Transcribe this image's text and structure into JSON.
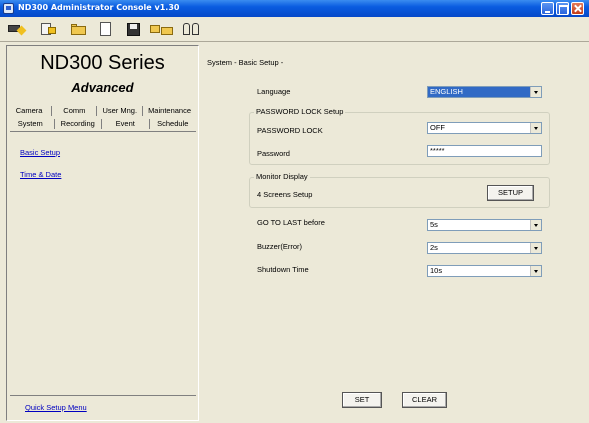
{
  "window": {
    "title": "ND300 Administrator Console v1.30"
  },
  "toolbar": {
    "icons": [
      "connect-icon",
      "login-icon",
      "open-folder-icon",
      "new-file-icon",
      "save-icon",
      "copy-folders-icon",
      "users-icon"
    ]
  },
  "sidebar": {
    "brand": "ND300 Series",
    "subtitle": "Advanced",
    "tabs_row1": [
      "Camera",
      "Comm",
      "User Mng.",
      "Maintenance"
    ],
    "tabs_row2": [
      "System",
      "Recording",
      "Event",
      "Schedule"
    ],
    "links": [
      "Basic Setup",
      "Time & Date"
    ],
    "quick_setup": "Quick Setup Menu"
  },
  "main": {
    "breadcrumb": "System - Basic Setup -",
    "language": {
      "label": "Language",
      "value": "ENGLISH"
    },
    "password_group": {
      "title": "PASSWORD LOCK Setup",
      "lock_label": "PASSWORD LOCK",
      "lock_value": "OFF",
      "password_label": "Password",
      "password_value": "*****"
    },
    "monitor_group": {
      "title": "Monitor Display",
      "screens_label": "4 Screens Setup",
      "setup_button": "SETUP"
    },
    "goto_last": {
      "label": "GO TO LAST before",
      "value": "5s"
    },
    "buzzer": {
      "label": "Buzzer(Error)",
      "value": "2s"
    },
    "shutdown": {
      "label": "Shutdown Time",
      "value": "10s"
    },
    "set_button": "SET",
    "clear_button": "CLEAR"
  },
  "colors": {
    "titlebar": "#0a5ce0",
    "link": "#0000c0",
    "highlight": "#316ac5",
    "background": "#ece9d8"
  }
}
